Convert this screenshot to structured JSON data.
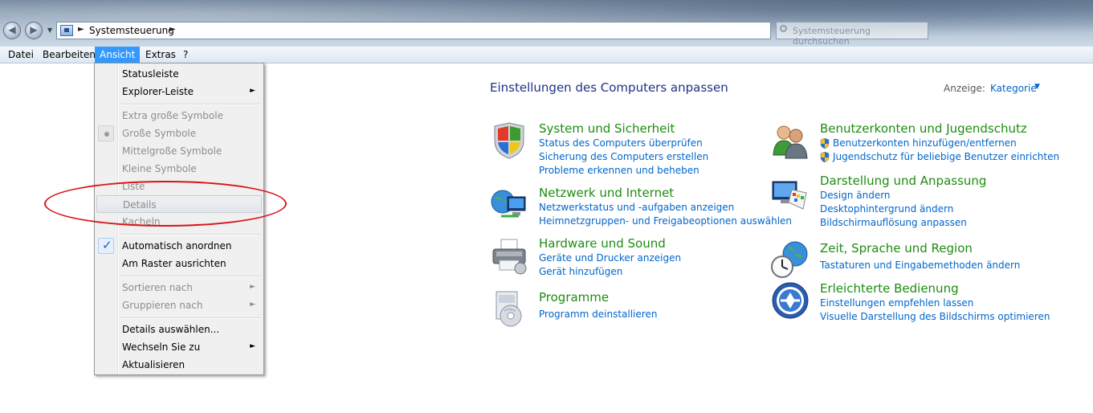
{
  "address": {
    "breadcrumb": "Systemsteuerung",
    "search_placeholder": "Systemsteuerung durchsuchen"
  },
  "menubar": {
    "items": [
      "Datei",
      "Bearbeiten",
      "Ansicht",
      "Extras",
      "?"
    ],
    "active": "Ansicht"
  },
  "dropdown": {
    "items": [
      {
        "label": "Statusleiste",
        "enabled": true
      },
      {
        "label": "Explorer-Leiste",
        "enabled": true,
        "submenu": true
      },
      {
        "label": "Extra große Symbole",
        "enabled": false
      },
      {
        "label": "Große Symbole",
        "enabled": false,
        "radio": true
      },
      {
        "label": "Mittelgroße Symbole",
        "enabled": false
      },
      {
        "label": "Kleine Symbole",
        "enabled": false
      },
      {
        "label": "Liste",
        "enabled": false
      },
      {
        "label": "Details",
        "enabled": false,
        "highlighted": true
      },
      {
        "label": "Kacheln",
        "enabled": false
      },
      {
        "label": "Automatisch anordnen",
        "enabled": true,
        "checked": true
      },
      {
        "label": "Am Raster ausrichten",
        "enabled": true
      },
      {
        "label": "Sortieren nach",
        "enabled": false,
        "submenu": true
      },
      {
        "label": "Gruppieren nach",
        "enabled": false,
        "submenu": true
      },
      {
        "label": "Details auswählen...",
        "enabled": true
      },
      {
        "label": "Wechseln Sie zu",
        "enabled": true,
        "submenu": true
      },
      {
        "label": "Aktualisieren",
        "enabled": true
      }
    ],
    "submenu_arrow": "►",
    "check_glyph": "✓"
  },
  "content": {
    "title": "Einstellungen des Computers anpassen",
    "view_label": "Anzeige:",
    "view_value": "Kategorie",
    "view_caret": "▼"
  },
  "categories": {
    "system": {
      "title": "System und Sicherheit",
      "links": [
        "Status des Computers überprüfen",
        "Sicherung des Computers erstellen",
        "Probleme erkennen und beheben"
      ],
      "icon": "shield-flag-icon"
    },
    "network": {
      "title": "Netzwerk und Internet",
      "links": [
        "Netzwerkstatus und -aufgaben anzeigen",
        "Heimnetzgruppen- und Freigabeoptionen auswählen"
      ],
      "icon": "network-globe-icon"
    },
    "hardware": {
      "title": "Hardware und Sound",
      "links": [
        "Geräte und Drucker anzeigen",
        "Gerät hinzufügen"
      ],
      "icon": "printer-icon"
    },
    "programs": {
      "title": "Programme",
      "links": [
        "Programm deinstallieren"
      ],
      "icon": "programs-disc-icon"
    },
    "users": {
      "title": "Benutzerkonten und Jugendschutz",
      "links": [
        "Benutzerkonten hinzufügen/entfernen",
        "Jugendschutz für beliebige Benutzer einrichten"
      ],
      "icon": "users-icon"
    },
    "appearance": {
      "title": "Darstellung und Anpassung",
      "links": [
        "Design ändern",
        "Desktophintergrund ändern",
        "Bildschirmauflösung anpassen"
      ],
      "icon": "display-palette-icon"
    },
    "clock": {
      "title": "Zeit, Sprache und Region",
      "links": [
        "Tastaturen und Eingabemethoden ändern"
      ],
      "icon": "clock-globe-icon"
    },
    "ease": {
      "title": "Erleichterte Bedienung",
      "links": [
        "Einstellungen empfehlen lassen",
        "Visuelle Darstellung des Bildschirms optimieren"
      ],
      "icon": "ease-of-access-icon"
    }
  },
  "colors": {
    "menu_highlight": "#3399ff",
    "link_blue": "#0066cc",
    "category_green": "#1e8c12",
    "title_blue": "#1e3287",
    "annotation_red": "#d8141b"
  }
}
